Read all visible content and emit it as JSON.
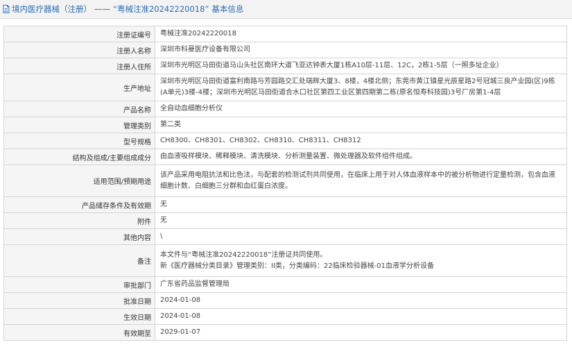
{
  "header": {
    "category": "境内医疗器械（注册）",
    "separator": "——",
    "reg_quote": "“粤械注准20242220018”",
    "suffix": "基本信息"
  },
  "rows": [
    {
      "label": "注册证编号",
      "value": "粤械注准20242220018"
    },
    {
      "label": "注册人名称",
      "value": "深圳市科曼医疗设备有限公司"
    },
    {
      "label": "注册人住所",
      "value": "深圳市光明区马田街道马山头社区南环大道飞亚达钟表大厦1栋A10层-11层、12C，2栋1-5层（一照多址企业）"
    },
    {
      "label": "生产地址",
      "value": "深圳市光明区马田街道富利南路与芳园路交汇处瑞辉大厦3、8楼，4楼北侧；东莞市黄江镇星光辰星路2号冠城三良产业园(区)9栋(A单元)3楼-4楼；深圳市光明区马田街道合水口社区第四工业区第四期第二栋(原名恒寿科技园)3号厂房第1-4层"
    },
    {
      "label": "产品名称",
      "value": "全自动血细胞分析仪"
    },
    {
      "label": "管理类别",
      "value": "第二类"
    },
    {
      "label": "型号规格",
      "value": "CH8300、CH8301、CH8302、CH8310、CH8311、CH8312"
    },
    {
      "label": "结构及组成/主要组成成分",
      "value": "由血液吸样模块、稀释模块、清洗模块、分析测量装置、微处理器及软件组件组成。"
    },
    {
      "label": "适用范围/预期用途",
      "value": "该产品采用电阻抗法和比色法，与配套的检测试剂共同使用，在临床上用于对人体血液样本中的被分析物进行定量检测，包含血液细胞计数、白细胞三分群和血红蛋白浓度。"
    },
    {
      "label": "产品储存条件及有效期",
      "value": "无"
    },
    {
      "label": "附件",
      "value": "无"
    },
    {
      "label": "其他内容",
      "value": "\\"
    },
    {
      "label": "备注",
      "value": "本文件与“粤械注准20242220018”注册证共同使用。\n新《医疗器械分类目录》管理类别：II类，分类编码：22临床检验器械-01血液学分析设备"
    },
    {
      "label": "审批部门",
      "value": "广东省药品监督管理局"
    },
    {
      "label": "批准日期",
      "value": "2024-01-08"
    },
    {
      "label": "生效日期",
      "value": "2024-01-08"
    },
    {
      "label": "有效期至",
      "value": "2029-01-07"
    }
  ]
}
